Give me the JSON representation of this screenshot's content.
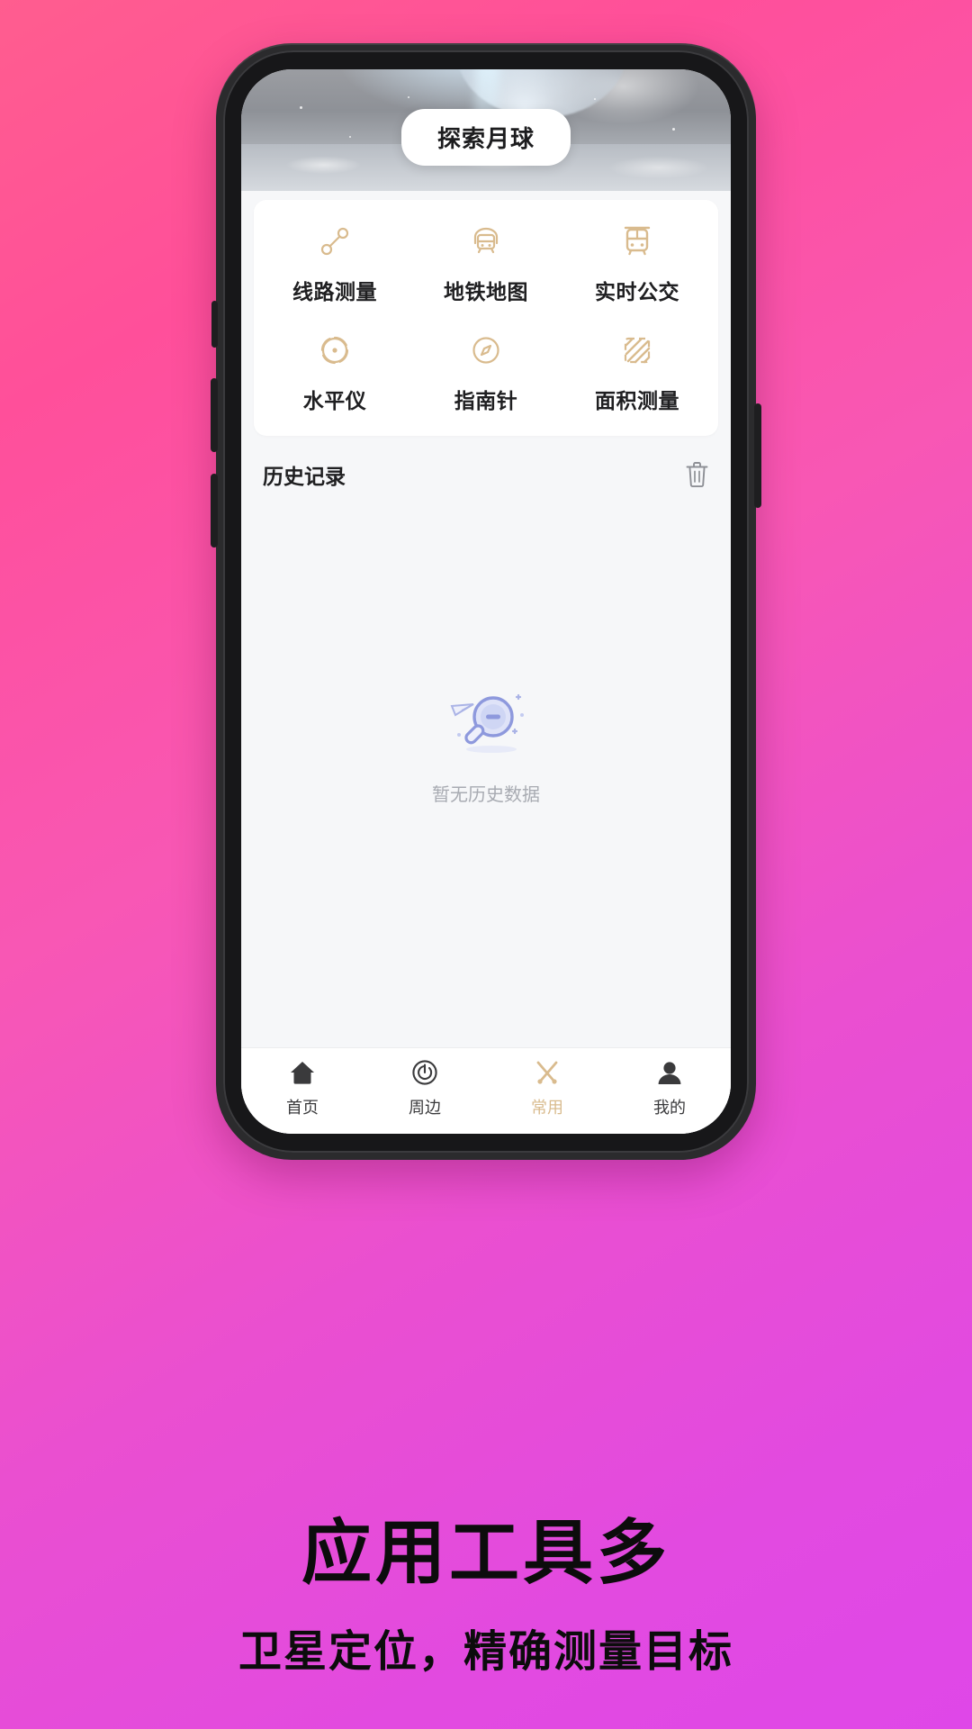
{
  "theme": {
    "background_gradient_start": "#ff5d8f",
    "background_gradient_end": "#df47e8",
    "icon_accent": "#d9bb8e",
    "active_tab_color": "#2b2b2d",
    "highlight_tab_color": "#d9bb8e",
    "empty_art_color": "#9aa3dd"
  },
  "header": {
    "title": "探索月球",
    "hero_icon": "moon-surface-image"
  },
  "tools": {
    "items": [
      {
        "label": "线路测量",
        "icon": "route-measure-icon"
      },
      {
        "label": "地铁地图",
        "icon": "subway-map-icon"
      },
      {
        "label": "实时公交",
        "icon": "realtime-bus-icon"
      },
      {
        "label": "水平仪",
        "icon": "spirit-level-icon"
      },
      {
        "label": "指南针",
        "icon": "compass-icon"
      },
      {
        "label": "面积测量",
        "icon": "area-measure-icon"
      }
    ]
  },
  "history": {
    "title": "历史记录",
    "clear_icon": "trash-icon",
    "empty_text": "暂无历史数据",
    "empty_icon": "magnifier-empty-icon"
  },
  "tabbar": {
    "items": [
      {
        "label": "首页",
        "icon": "home-icon",
        "state": "active"
      },
      {
        "label": "周边",
        "icon": "nearby-icon",
        "state": "normal"
      },
      {
        "label": "常用",
        "icon": "tools-icon",
        "state": "highlight"
      },
      {
        "label": "我的",
        "icon": "profile-icon",
        "state": "normal"
      }
    ]
  },
  "promo": {
    "headline": "应用工具多",
    "subline": "卫星定位，精确测量目标"
  }
}
